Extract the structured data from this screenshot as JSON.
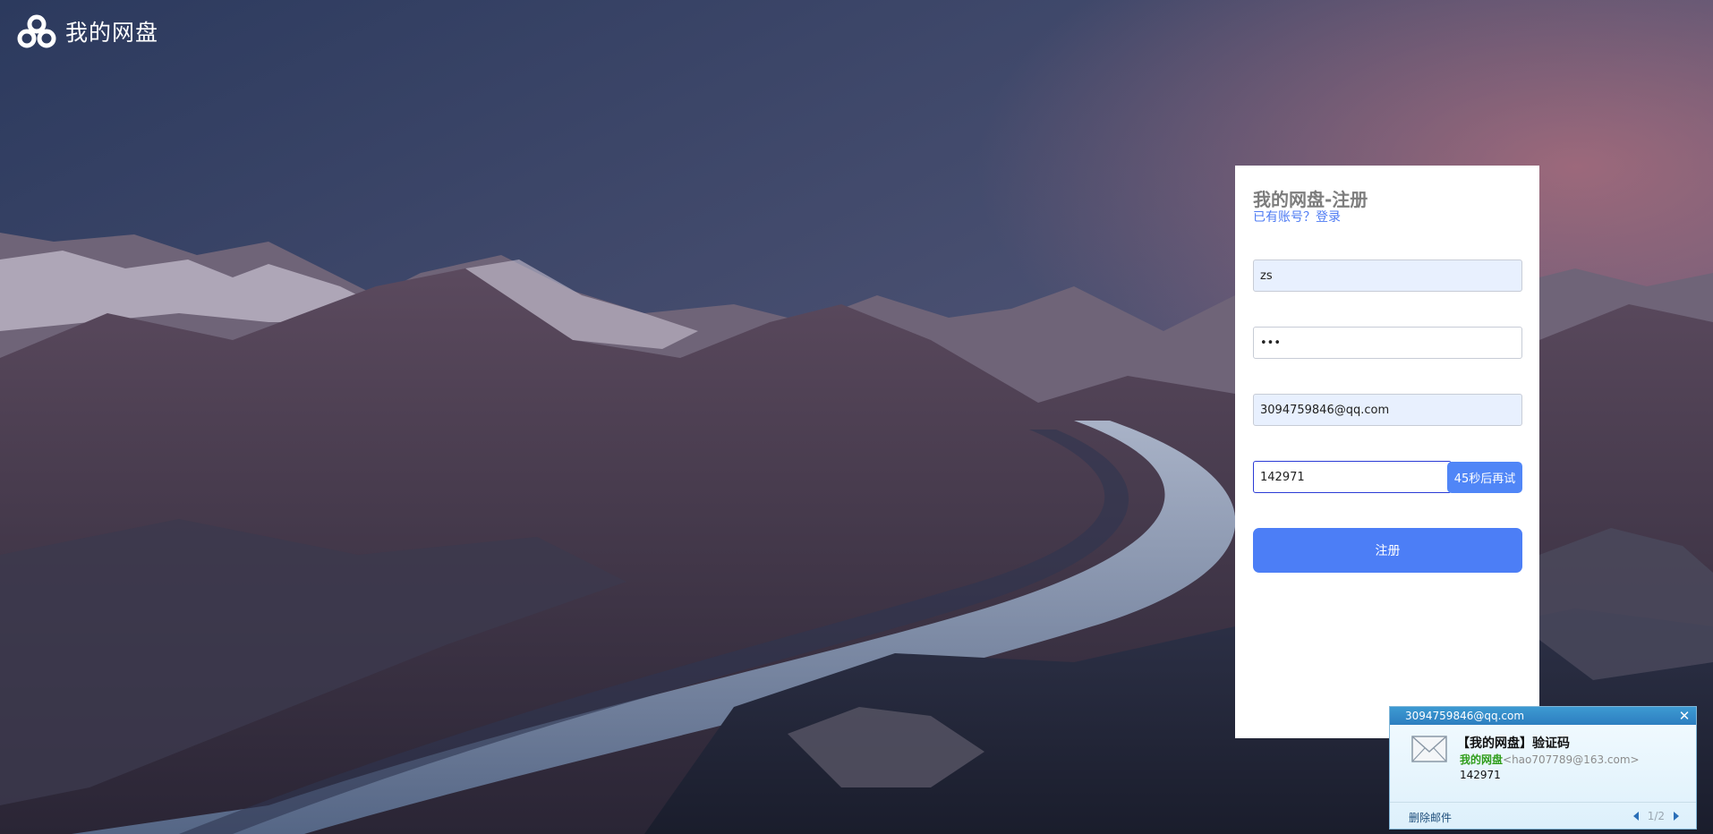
{
  "app": {
    "name": "我的网盘"
  },
  "form": {
    "title": "我的网盘-注册",
    "login_link": "已有账号？登录",
    "username_value": "zs",
    "password_value": "•••",
    "email_value": "3094759846@qq.com",
    "code_value": "142971",
    "code_button": "45秒后再试",
    "submit_label": "注册"
  },
  "notification": {
    "account": "3094759846@qq.com",
    "subject": "【我的网盘】验证码",
    "from_name": "我的网盘",
    "from_address": "<hao707789@163.com>",
    "body": "142971",
    "delete_label": "删除邮件",
    "page": "1/2"
  },
  "colors": {
    "accent": "#4c7ef6",
    "panel_bg": "#ffffff",
    "notify_header": "#2d7ec0"
  },
  "icons": {
    "logo": "cloud-logo-icon",
    "close": "close-icon",
    "mail": "envelope-icon",
    "prev": "prev-arrow-icon",
    "next": "next-arrow-icon"
  }
}
